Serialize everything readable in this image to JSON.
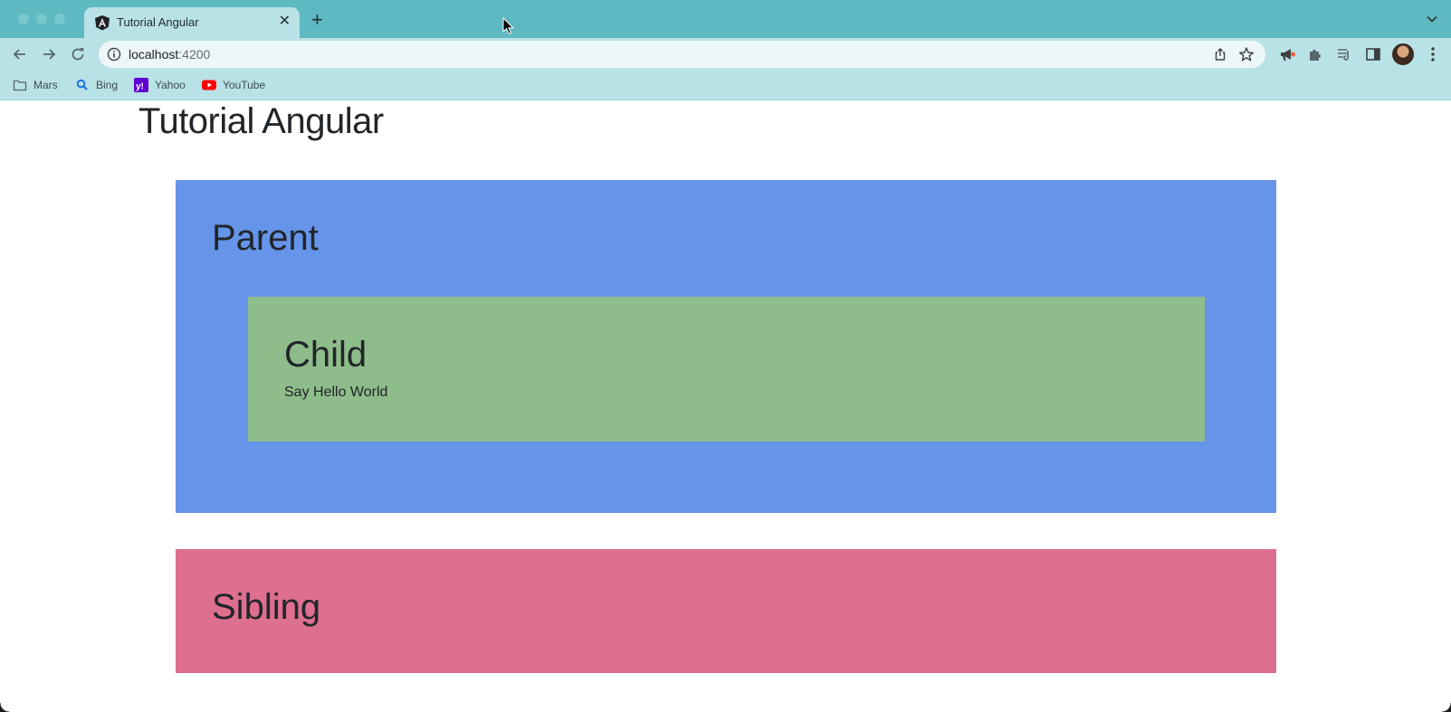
{
  "browser": {
    "tab": {
      "title": "Tutorial Angular",
      "favicon": "angular-logo-icon",
      "close_icon": "close-icon"
    },
    "new_tab_icon": "plus-icon",
    "tab_menu_icon": "chevron-down-icon",
    "address": {
      "host": "localhost",
      "port": ":4200"
    },
    "bookmarks": [
      {
        "label": "Mars",
        "icon": "folder-icon"
      },
      {
        "label": "Bing",
        "icon": "bing-search-icon"
      },
      {
        "label": "Yahoo",
        "icon": "yahoo-icon"
      },
      {
        "label": "YouTube",
        "icon": "youtube-icon"
      }
    ]
  },
  "page": {
    "title": "Tutorial Angular",
    "parent": {
      "heading": "Parent",
      "color": "#6694e9"
    },
    "child": {
      "heading": "Child",
      "message": "Say Hello World",
      "color": "#8fbc8b"
    },
    "sibling": {
      "heading": "Sibling",
      "color": "#dd6f8f"
    }
  },
  "colors": {
    "titlebar": "#5fb9c2",
    "toolbar": "#b9e2e6",
    "text": "#212529"
  }
}
